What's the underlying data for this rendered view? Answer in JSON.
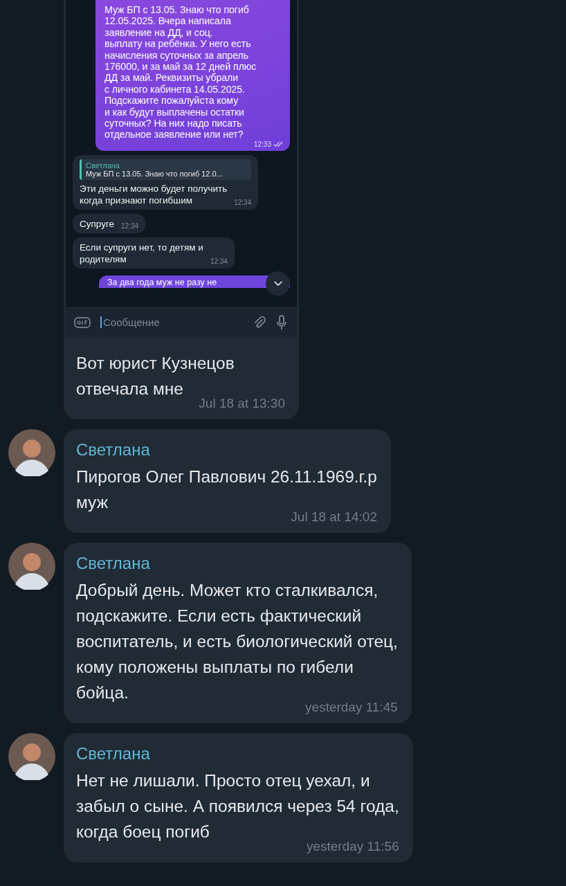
{
  "messages": [
    {
      "kind": "screenshot",
      "screenshot": {
        "messages": [
          {
            "kind": "outgoing",
            "text": "Муж БП с 13.05. Знаю что погиб\n12.05.2025. Вчера написала\nзаявление на ДД, и соц.\nвыплату на ребёнка. У него есть\nначисления суточных за апрель\n176000, и за май за 12 дней   плюс\nДД за май. Реквизиты убрали\nс личного кабинета 14.05.2025.\nПодскажите пожалуйста кому\nи как будут выплачены остатки\nсуточных? На них надо писать\nотдельное заявление или нет?",
            "time": "12:33",
            "read": true
          },
          {
            "kind": "incoming",
            "reply": {
              "name": "Светлана",
              "text": "Муж БП с 13.05. Знаю что погиб 12.0..."
            },
            "text": "Эти деньги можно будет получить\nкогда признают погибшим",
            "time": "12:34"
          },
          {
            "kind": "incoming",
            "text": "Супруге",
            "time": "12:34"
          },
          {
            "kind": "incoming",
            "text": "Если супруги нет, то детям и\nродителям",
            "time": "12:34"
          },
          {
            "kind": "outgoing_cut",
            "text": "За два года муж не разу не"
          }
        ],
        "input": {
          "placeholder": "Сообщение"
        }
      },
      "text": "Вот юрист Кузнецов\nотвечала мне",
      "time": "Jul 18 at 13:30"
    },
    {
      "kind": "text",
      "sender": "Светлана",
      "text": "Пирогов Олег Павлович 26.11.1969.г.р\nмуж",
      "time": "Jul 18 at 14:02"
    },
    {
      "kind": "text",
      "sender": "Светлана",
      "text": "Добрый день. Может кто сталкивался,\nподскажите. Если есть фактический\nвоспитатель, и есть биологический отец,\nкому положены выплаты по гибели\nбойца.",
      "time": "yesterday 11:45"
    },
    {
      "kind": "text",
      "sender": "Светлана",
      "text": "Нет не лишали. Просто отец уехал, и\nзабыл о сыне. А появился через 54 года,\nкогда боец погиб",
      "time": "yesterday 11:56"
    }
  ]
}
